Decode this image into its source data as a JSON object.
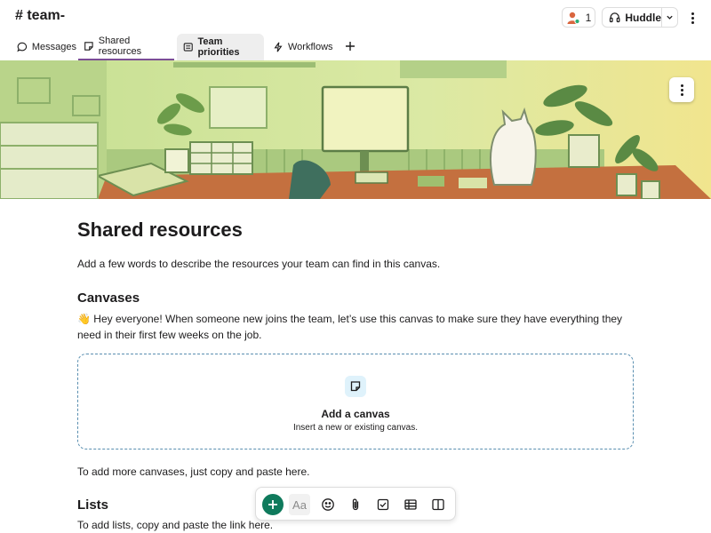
{
  "header": {
    "channel_title": "# team-",
    "member_count": "1",
    "huddle_label": "Huddle"
  },
  "tabs": [
    {
      "label": "Messages",
      "icon": "message-icon"
    },
    {
      "label": "Shared resources",
      "icon": "canvas-icon"
    },
    {
      "label": "Team priorities",
      "icon": "list-icon"
    },
    {
      "label": "Workflows",
      "icon": "lightning-icon"
    }
  ],
  "content": {
    "title": "Shared resources",
    "intro": "Add a few words to describe the resources your team can find in this canvas.",
    "canvases_heading": "Canvases",
    "canvases_emoji": "👋",
    "canvases_text": "Hey everyone! When someone new joins the team, let’s use this canvas to make sure they have everything they need in their first few weeks on the job.",
    "add_canvas_title": "Add a canvas",
    "add_canvas_subtitle": "Insert a new or existing canvas.",
    "more_canvases_text": "To add more canvases, just copy and paste here.",
    "lists_heading": "Lists",
    "lists_text": "To add lists, copy and paste the link here."
  },
  "toolbar": {
    "text_format_label": "Aa",
    "buttons": [
      "plus-icon",
      "text-format-icon",
      "emoji-icon",
      "attachment-icon",
      "checkbox-icon",
      "table-icon",
      "columns-icon"
    ]
  },
  "colors": {
    "accent": "#7b4d96",
    "primary_green": "#0f7a5c",
    "dashed_border": "#5a8fb0",
    "banner_green": "#cfe49c"
  }
}
